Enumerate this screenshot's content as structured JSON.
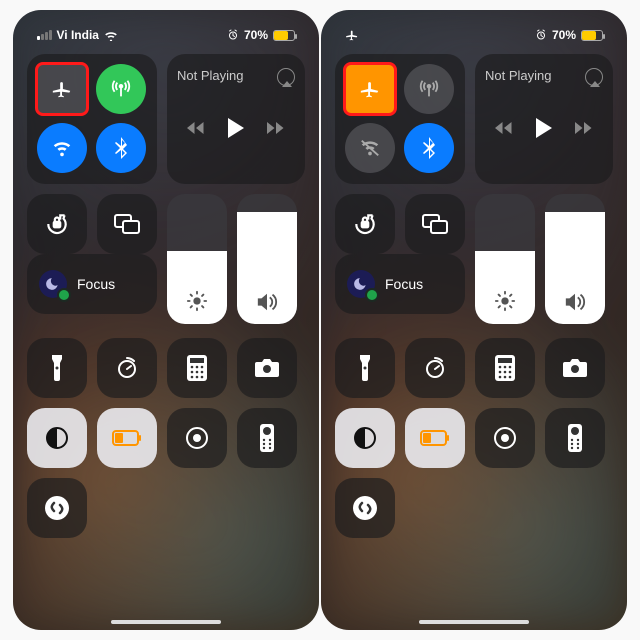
{
  "panels": [
    {
      "status": {
        "carrier": "Vi India",
        "showCarrier": true,
        "showAirplaneIcon": false,
        "batteryPct": "70%",
        "alarmSet": true
      },
      "connectivity": {
        "airplane": {
          "on": false,
          "highlighted": true
        },
        "cellular": {
          "on": true
        },
        "wifi": {
          "on": true
        },
        "bluetooth": {
          "on": true
        }
      },
      "media": {
        "title": "Not Playing"
      },
      "focus": {
        "label": "Focus"
      },
      "brightnessPct": 56,
      "volumePct": 86,
      "toggles": [
        "rotation-lock",
        "screen-mirroring",
        "flashlight",
        "timer",
        "calculator",
        "camera",
        "dark-mode",
        "low-power-on",
        "screen-record",
        "apple-tv-remote",
        "shazam"
      ],
      "lowPowerActive": true
    },
    {
      "status": {
        "carrier": "",
        "showCarrier": false,
        "showAirplaneIcon": true,
        "batteryPct": "70%",
        "alarmSet": true
      },
      "connectivity": {
        "airplane": {
          "on": true,
          "highlighted": true
        },
        "cellular": {
          "on": false
        },
        "wifi": {
          "on": false
        },
        "bluetooth": {
          "on": true
        }
      },
      "media": {
        "title": "Not Playing"
      },
      "focus": {
        "label": "Focus"
      },
      "brightnessPct": 56,
      "volumePct": 86,
      "toggles": [
        "rotation-lock",
        "screen-mirroring",
        "flashlight",
        "timer",
        "calculator",
        "camera",
        "dark-mode",
        "low-power-on",
        "screen-record",
        "apple-tv-remote",
        "shazam"
      ],
      "lowPowerActive": true
    }
  ]
}
